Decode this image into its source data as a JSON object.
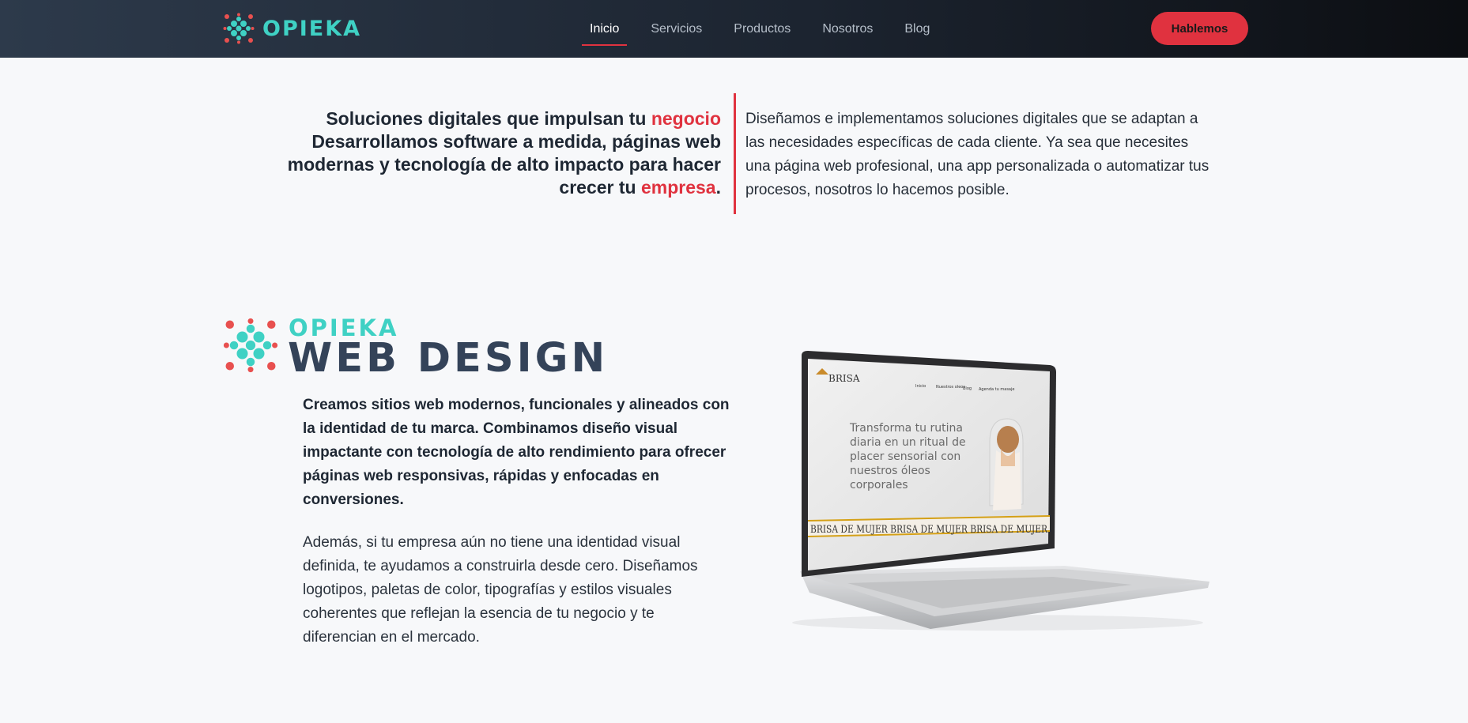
{
  "header": {
    "brand": "OPIEKA",
    "nav": [
      {
        "label": "Inicio",
        "active": true
      },
      {
        "label": "Servicios",
        "active": false
      },
      {
        "label": "Productos",
        "active": false
      },
      {
        "label": "Nosotros",
        "active": false
      },
      {
        "label": "Blog",
        "active": false
      }
    ],
    "cta_label": "Hablemos"
  },
  "intro": {
    "headline_part1": "Soluciones digitales que impulsan tu ",
    "headline_accent1": "negocio",
    "headline_part2": " Desarrollamos software a medida, páginas web modernas y tecnología de alto impacto para hacer crecer tu ",
    "headline_accent2": "empresa",
    "headline_end": ".",
    "description": "Diseñamos e implementamos soluciones digitales que se adaptan a las necesidades específicas de cada cliente. Ya sea que necesites una página web profesional, una app personalizada o automatizar tus procesos, nosotros lo hacemos posible."
  },
  "web_design": {
    "logo_brand": "OPIEKA",
    "logo_title": "WEB DESIGN",
    "paragraph_bold": "Creamos sitios web modernos, funcionales y alineados con la identidad de tu marca. Combinamos diseño visual impactante con tecnología de alto rendimiento para ofrecer páginas web responsivas, rápidas y enfocadas en conversiones.",
    "paragraph": "Además, si tu empresa aún no tiene una identidad visual definida, te ayudamos a construirla desde cero. Diseñamos logotipos, paletas de color, tipografías y estilos visuales coherentes que reflejan la esencia de tu negocio y te diferencian en el mercado."
  },
  "laptop_screen": {
    "site_logo": "BRISA",
    "nav": [
      "Inicio",
      "Nuestros oleos",
      "Blog",
      "Agenda tu masaje"
    ],
    "hero_text": [
      "Transforma tu rutina",
      "diaria en un ritual de",
      "placer sensorial con",
      "nuestros óleos",
      "corporales"
    ],
    "marquee": "BRISA DE MUJER BRISA DE MUJER BRISA DE MUJER"
  },
  "colors": {
    "accent": "#e0323f",
    "brand_teal": "#3fd1c4",
    "title_slate": "#344359",
    "background": "#f7f8fa"
  }
}
